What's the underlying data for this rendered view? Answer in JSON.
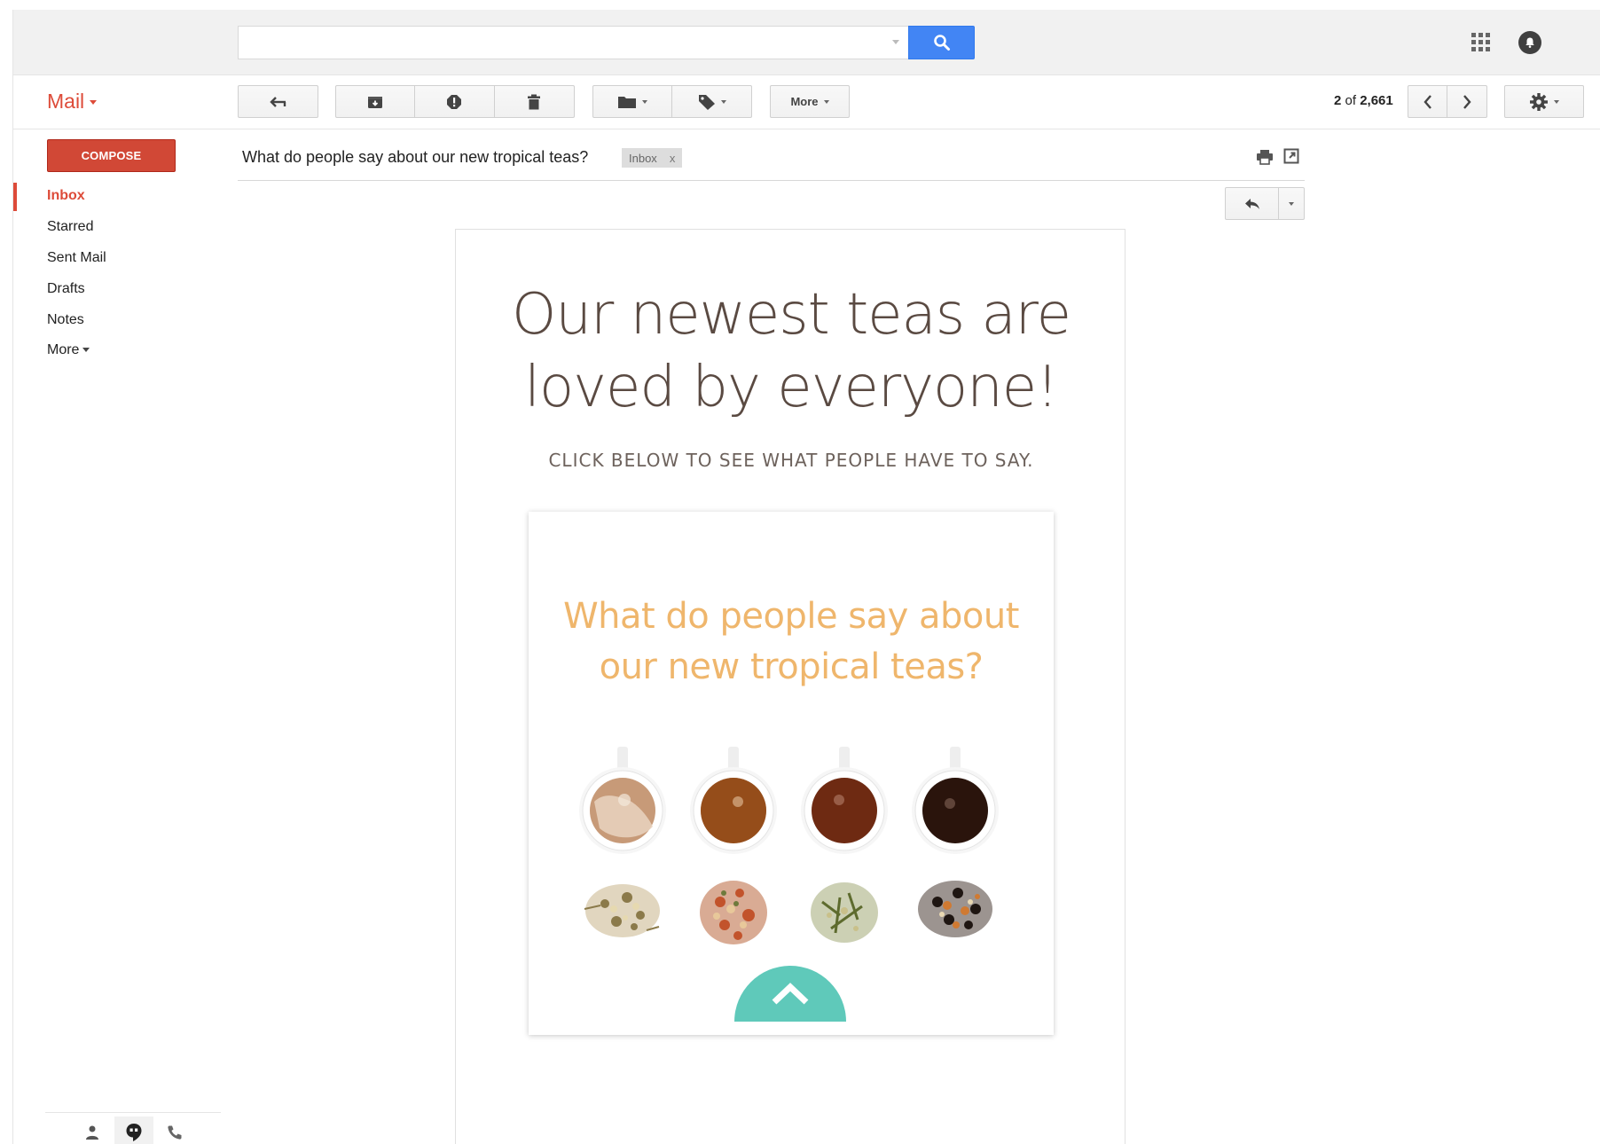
{
  "app": {
    "title": "Mail",
    "brand_color": "#dd4b39",
    "accent_blue": "#4285f4"
  },
  "search": {
    "placeholder": "",
    "value": ""
  },
  "toolbar": {
    "more_label": "More",
    "pager": {
      "current": "2",
      "of_label": "of",
      "total": "2,661"
    }
  },
  "sidebar": {
    "compose_label": "COMPOSE",
    "items": [
      {
        "label": "Inbox",
        "active": true
      },
      {
        "label": "Starred"
      },
      {
        "label": "Sent Mail"
      },
      {
        "label": "Drafts"
      },
      {
        "label": "Notes"
      },
      {
        "label": "More"
      }
    ]
  },
  "message": {
    "subject": "What do people say about our new tropical teas?",
    "label_chip": "Inbox",
    "label_remove": "x"
  },
  "email_body": {
    "headline_line1": "Our newest teas are",
    "headline_line2": "loved by everyone!",
    "subline": "CLICK BELOW TO SEE WHAT PEOPLE HAVE TO SAY.",
    "promo_line1": "What do people say about",
    "promo_line2": "our new tropical teas?",
    "teal_color": "#5fc9ba",
    "promo_text_color": "#efb66c"
  },
  "icons": {
    "search": "search-icon",
    "apps": "apps-grid-icon",
    "notifications": "notifications-icon",
    "reply": "reply-icon",
    "archive": "archive-icon",
    "spam": "report-spam-icon",
    "delete": "trash-icon",
    "move": "folder-icon",
    "labels": "label-icon",
    "prev": "chevron-left-icon",
    "next": "chevron-right-icon",
    "settings": "gear-icon",
    "print": "print-icon",
    "new_window": "new-window-icon",
    "contacts": "person-icon",
    "hangouts": "hangouts-icon",
    "phone": "phone-icon"
  }
}
